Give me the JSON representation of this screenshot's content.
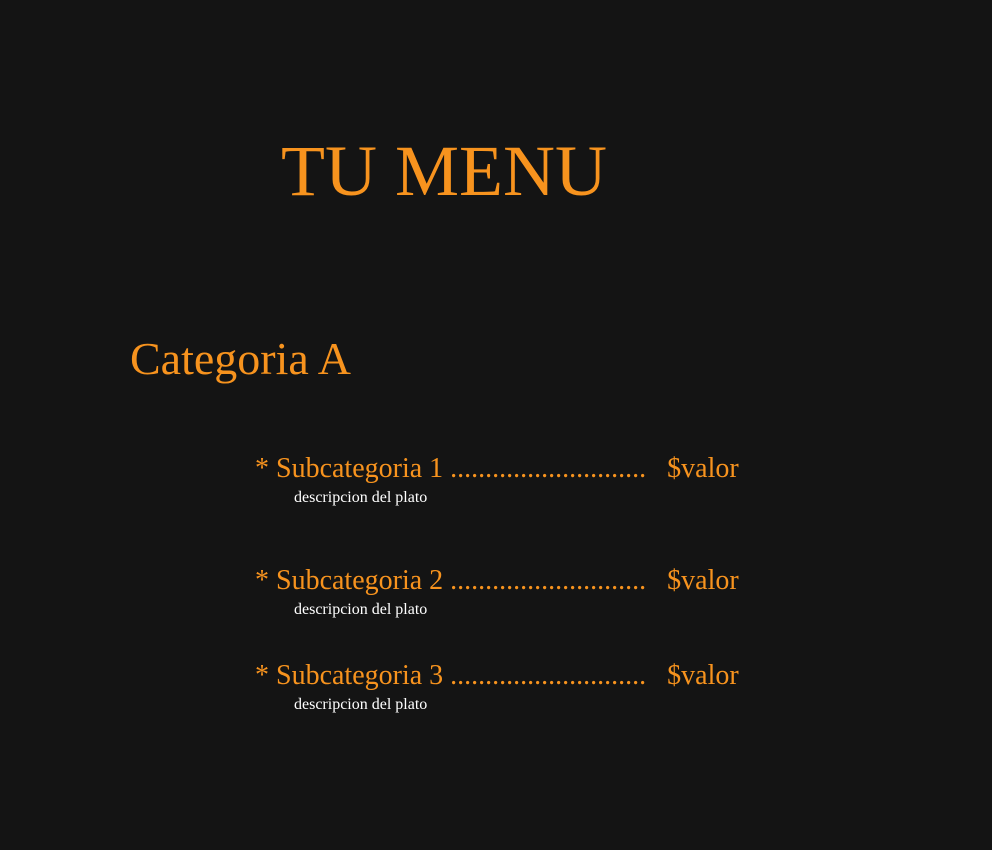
{
  "menu": {
    "title": "TU MENU"
  },
  "category": {
    "title": "Categoria A",
    "items": [
      {
        "bullet": "*",
        "name": "Subcategoria 1",
        "leader": "............................",
        "price": "$valor",
        "description": "descripcion del plato"
      },
      {
        "bullet": "*",
        "name": "Subcategoria 2",
        "leader": "............................",
        "price": "$valor",
        "description": "descripcion del plato"
      },
      {
        "bullet": "*",
        "name": "Subcategoria 3",
        "leader": "............................",
        "price": "$valor",
        "description": "descripcion del plato"
      }
    ]
  },
  "colors": {
    "background": "#141414",
    "accent": "#f7931e",
    "description_text": "#ffffff"
  }
}
